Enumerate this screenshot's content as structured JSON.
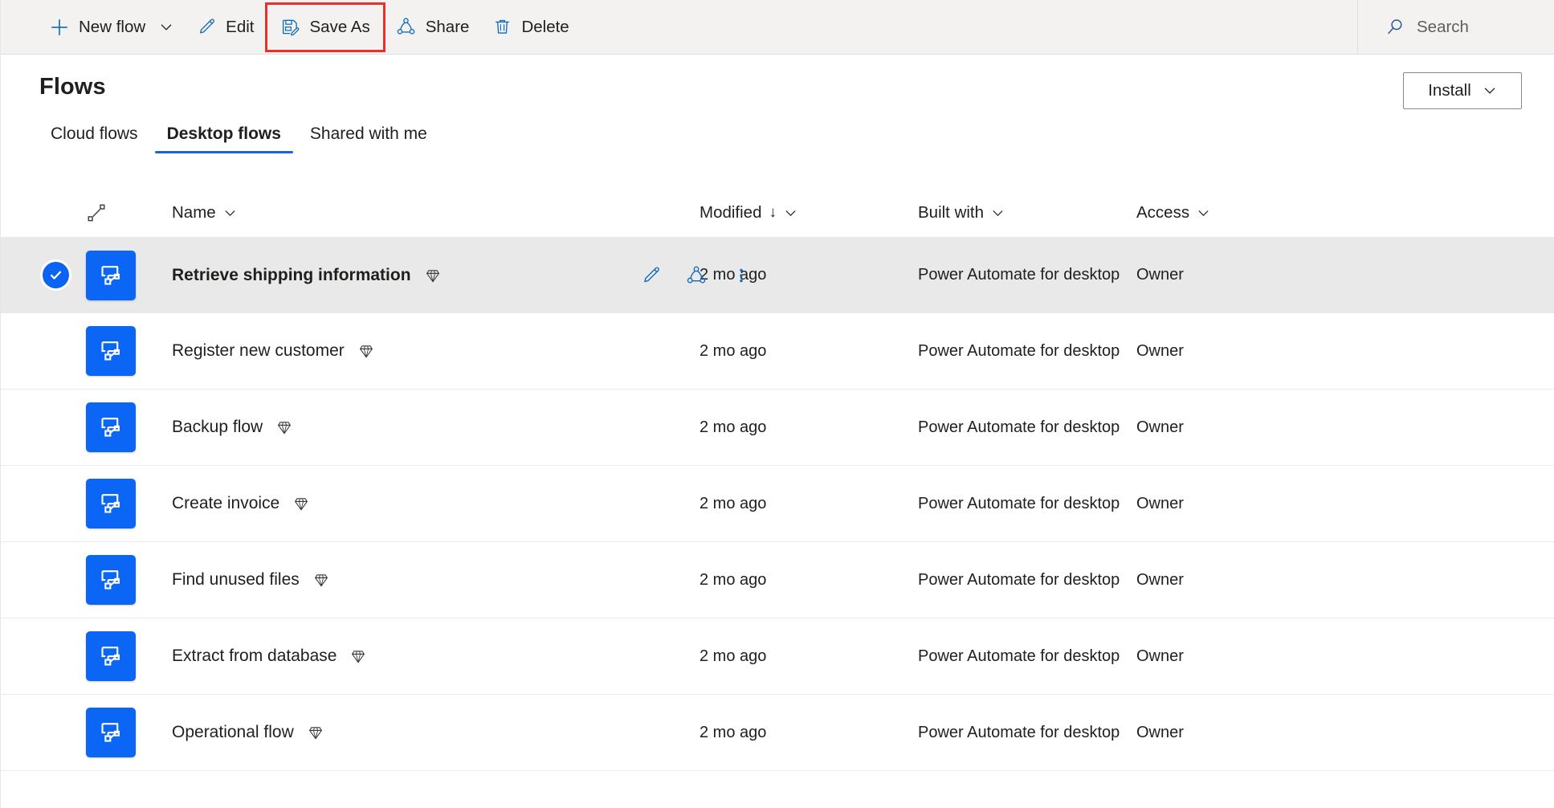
{
  "toolbar": {
    "new_flow": {
      "label": "New flow",
      "icon": "plus-icon",
      "chevron": "chevron-down-icon"
    },
    "edit": {
      "label": "Edit",
      "icon": "pencil-icon"
    },
    "save_as": {
      "label": "Save As",
      "icon": "save-as-icon",
      "highlight_color": "#e8312a"
    },
    "share": {
      "label": "Share",
      "icon": "share-icon"
    },
    "delete": {
      "label": "Delete",
      "icon": "trash-icon"
    },
    "search": {
      "placeholder": "Search",
      "icon": "search-icon"
    },
    "accent_color": "#0f6cbd"
  },
  "page": {
    "title": "Flows",
    "install": {
      "label": "Install",
      "icon": "chevron-down-icon"
    }
  },
  "tabs": [
    {
      "label": "Cloud flows",
      "active": false
    },
    {
      "label": "Desktop flows",
      "active": true
    },
    {
      "label": "Shared with me",
      "active": false
    }
  ],
  "table": {
    "columns": {
      "type_icon": "flow-type-icon",
      "name": "Name",
      "modified": "Modified",
      "modified_sort": "↓",
      "built_with": "Built with",
      "access": "Access"
    },
    "row_actions": {
      "edit": "pencil-icon",
      "share": "share-icon",
      "more": "more-vertical-icon"
    },
    "rows": [
      {
        "name": "Retrieve shipping information",
        "modified": "2 mo ago",
        "built_with": "Power Automate for desktop",
        "access": "Owner",
        "selected": true,
        "premium": true
      },
      {
        "name": "Register new customer",
        "modified": "2 mo ago",
        "built_with": "Power Automate for desktop",
        "access": "Owner",
        "selected": false,
        "premium": true
      },
      {
        "name": "Backup flow",
        "modified": "2 mo ago",
        "built_with": "Power Automate for desktop",
        "access": "Owner",
        "selected": false,
        "premium": true
      },
      {
        "name": "Create invoice",
        "modified": "2 mo ago",
        "built_with": "Power Automate for desktop",
        "access": "Owner",
        "selected": false,
        "premium": true
      },
      {
        "name": "Find unused files",
        "modified": "2 mo ago",
        "built_with": "Power Automate for desktop",
        "access": "Owner",
        "selected": false,
        "premium": true
      },
      {
        "name": "Extract from database",
        "modified": "2 mo ago",
        "built_with": "Power Automate for desktop",
        "access": "Owner",
        "selected": false,
        "premium": true
      },
      {
        "name": "Operational flow",
        "modified": "2 mo ago",
        "built_with": "Power Automate for desktop",
        "access": "Owner",
        "selected": false,
        "premium": true
      }
    ]
  },
  "colors": {
    "brand_blue": "#0b66f5",
    "accent_blue": "#0f6cbd",
    "tab_underline": "#1268d8",
    "highlight_red": "#e8312a",
    "selected_row": "#e9e9e9"
  }
}
